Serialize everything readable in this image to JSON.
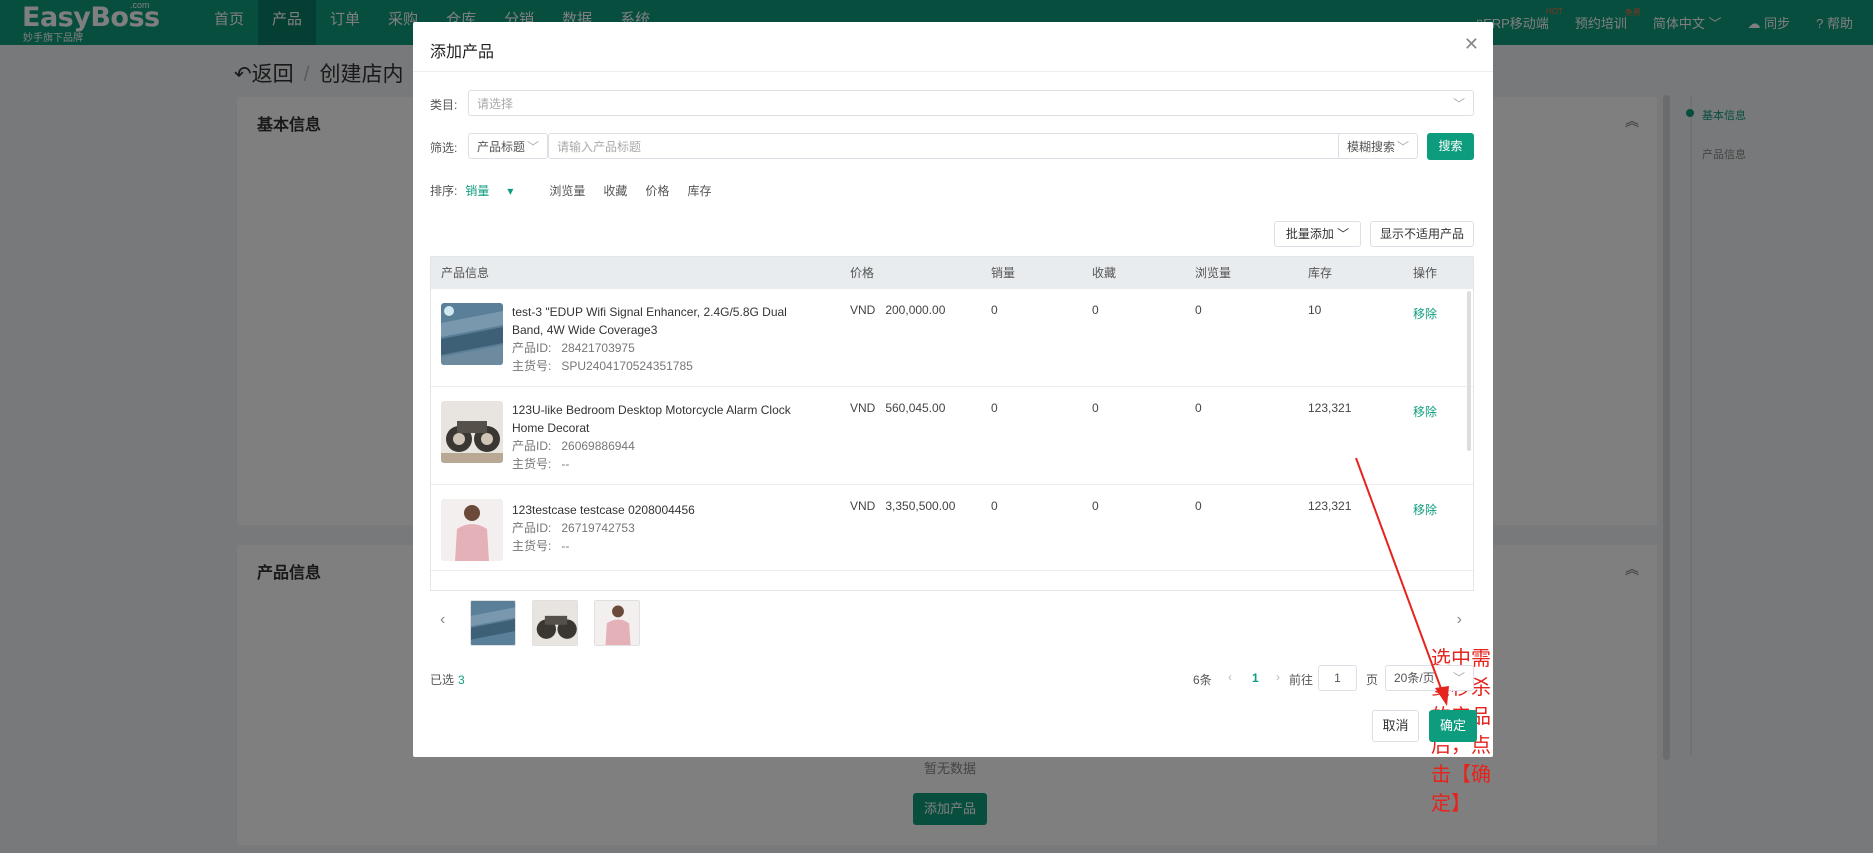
{
  "app": {
    "logo_main": "EasyBoss",
    "logo_com": ".com",
    "logo_tagline": "妙手旗下品牌",
    "nav": [
      "首页",
      "产品",
      "订单",
      "采购",
      "仓库",
      "分销",
      "数据",
      "系统"
    ],
    "nav_active": 1,
    "right": {
      "mobile": "ERP移动端",
      "mobile_badge": "HOT",
      "training": "预约培训",
      "training_badge": "免费",
      "language": "简体中文",
      "sync": "同步",
      "help": "帮助"
    }
  },
  "page": {
    "back": "返回",
    "title": "创建店内",
    "sections": {
      "basic": "基本信息",
      "product": "产品信息"
    },
    "anchors": [
      "基本信息",
      "产品信息"
    ],
    "empty_text": "暂无数据",
    "add_button": "添加产品"
  },
  "modal": {
    "title": "添加产品",
    "category_label": "类目:",
    "category_placeholder": "请选择",
    "filter_label": "筛选:",
    "filter_field": "产品标题",
    "filter_placeholder": "请输入产品标题",
    "match_mode": "模糊搜索",
    "search_button": "搜索",
    "sort_label": "排序:",
    "sort_options": [
      "销量",
      "浏览量",
      "收藏",
      "价格",
      "库存"
    ],
    "batch_add": "批量添加",
    "show_unavailable": "显示不适用产品",
    "columns": [
      "产品信息",
      "价格",
      "销量",
      "收藏",
      "浏览量",
      "库存",
      "操作"
    ],
    "id_label": "产品ID:",
    "sku_label": "主货号:",
    "rows": [
      {
        "title": "test-3 \"EDUP Wifi Signal Enhancer, 2.4G/5.8G Dual Band, 4W Wide Coverage3",
        "id": "28421703975",
        "sku": "SPU2404170524351785",
        "price": "VND   200,000.00",
        "sales": "0",
        "favorites": "0",
        "views": "0",
        "stock": "10",
        "action": "移除"
      },
      {
        "title": "123U-like Bedroom Desktop Motorcycle Alarm Clock Home Decorat",
        "id": "26069886944",
        "sku": "--",
        "price": "VND   560,045.00",
        "sales": "0",
        "favorites": "0",
        "views": "0",
        "stock": "123,321",
        "action": "移除"
      },
      {
        "title": "123testcase testcase 0208004456",
        "id": "26719742753",
        "sku": "--",
        "price": "VND   3,350,500.00",
        "sales": "0",
        "favorites": "0",
        "views": "0",
        "stock": "123,321",
        "action": "移除"
      }
    ],
    "annotation": "选中需要秒杀的产品后，点击【确定】",
    "selected_label": "已选",
    "selected_count": "3",
    "total": "6条",
    "current_page": "1",
    "goto_label": "前往",
    "goto_value": "1",
    "page_unit": "页",
    "page_size": "20条/页",
    "cancel": "取消",
    "confirm": "确定"
  },
  "colors": {
    "brand": "#0e9c7e",
    "annotation": "#e6231c"
  }
}
